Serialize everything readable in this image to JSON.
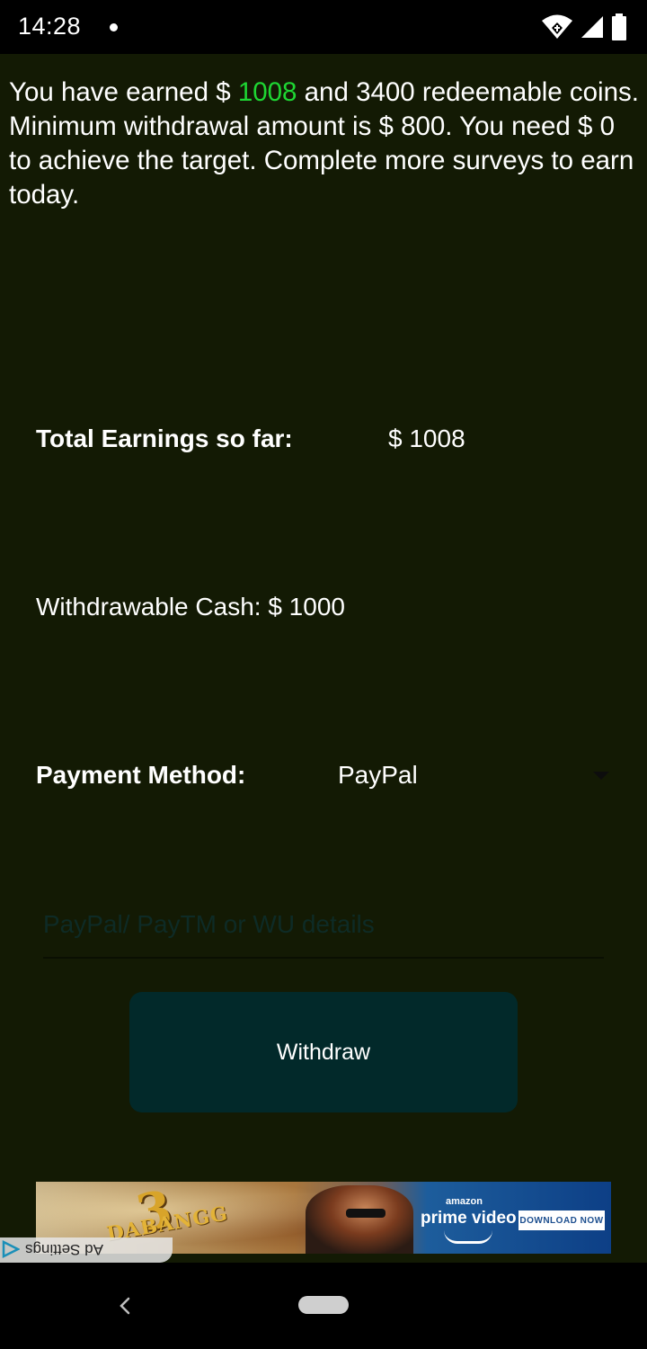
{
  "status_bar": {
    "time": "14:28",
    "icons": [
      "notification-dot-icon",
      "wifi-data-saver-icon",
      "cellular-signal-icon",
      "battery-icon"
    ]
  },
  "intro": {
    "prefix": "You have earned $ ",
    "earned_amount": "1008",
    "suffix": " and 3400 redeemable coins. Minimum withdrawal amount is $ 800. You need $ 0 to achieve the target. Complete more surveys to earn today.",
    "earned_color": "#1ED633"
  },
  "earnings": {
    "label": "Total Earnings so far:",
    "value": "$ 1008"
  },
  "withdrawable": {
    "text": "Withdrawable Cash: $ 1000"
  },
  "payment": {
    "label": "Payment Method:",
    "selected": "PayPal"
  },
  "details_input": {
    "placeholder": "PayPal/ PayTM or WU details",
    "value": ""
  },
  "withdraw_button": {
    "label": "Withdraw"
  },
  "ad": {
    "movie_number": "3",
    "movie_title": "DABANGG",
    "brand_top": "amazon",
    "brand_main": "prime video",
    "cta": "DOWNLOAD NOW",
    "settings_text": "Ad Settings"
  },
  "colors": {
    "background": "#131A04",
    "button": "#02292A",
    "accent_green": "#1ED633"
  }
}
